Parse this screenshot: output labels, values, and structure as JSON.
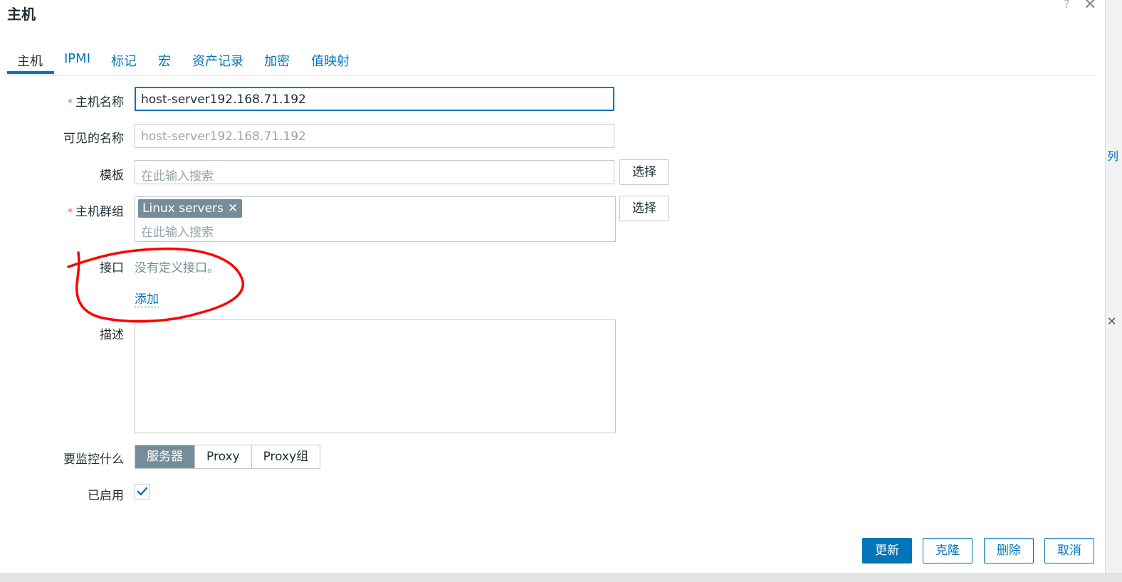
{
  "dialog": {
    "title": "主机",
    "help_glyph": "?",
    "close_glyph": "✕"
  },
  "tabs": [
    {
      "label": "主机",
      "active": true
    },
    {
      "label": "IPMI"
    },
    {
      "label": "标记"
    },
    {
      "label": "宏"
    },
    {
      "label": "资产记录"
    },
    {
      "label": "加密"
    },
    {
      "label": "值映射"
    }
  ],
  "form": {
    "required_mark": "*",
    "host_name": {
      "label": "主机名称",
      "value": "host-server192.168.71.192"
    },
    "visible_name": {
      "label": "可见的名称",
      "placeholder": "host-server192.168.71.192"
    },
    "templates": {
      "label": "模板",
      "placeholder": "在此输入搜索",
      "select_label": "选择"
    },
    "host_groups": {
      "label": "主机群组",
      "chip": "Linux servers",
      "chip_remove": "✕",
      "placeholder": "在此输入搜索",
      "select_label": "选择"
    },
    "interfaces": {
      "label": "接口",
      "empty_text": "没有定义接口。",
      "add_label": "添加"
    },
    "description": {
      "label": "描述",
      "value": ""
    },
    "monitored_by": {
      "label": "要监控什么",
      "options": [
        "服务器",
        "Proxy",
        "Proxy组"
      ],
      "selected": "服务器"
    },
    "enabled": {
      "label": "已启用",
      "checked": true
    }
  },
  "footer": {
    "update": "更新",
    "clone": "克隆",
    "delete": "删除",
    "cancel": "取消"
  },
  "colors": {
    "accent": "#0275b8",
    "annotation": "#ff0000",
    "chip_bg": "#768d99"
  },
  "background_fragments": [
    "列",
    "✕"
  ]
}
